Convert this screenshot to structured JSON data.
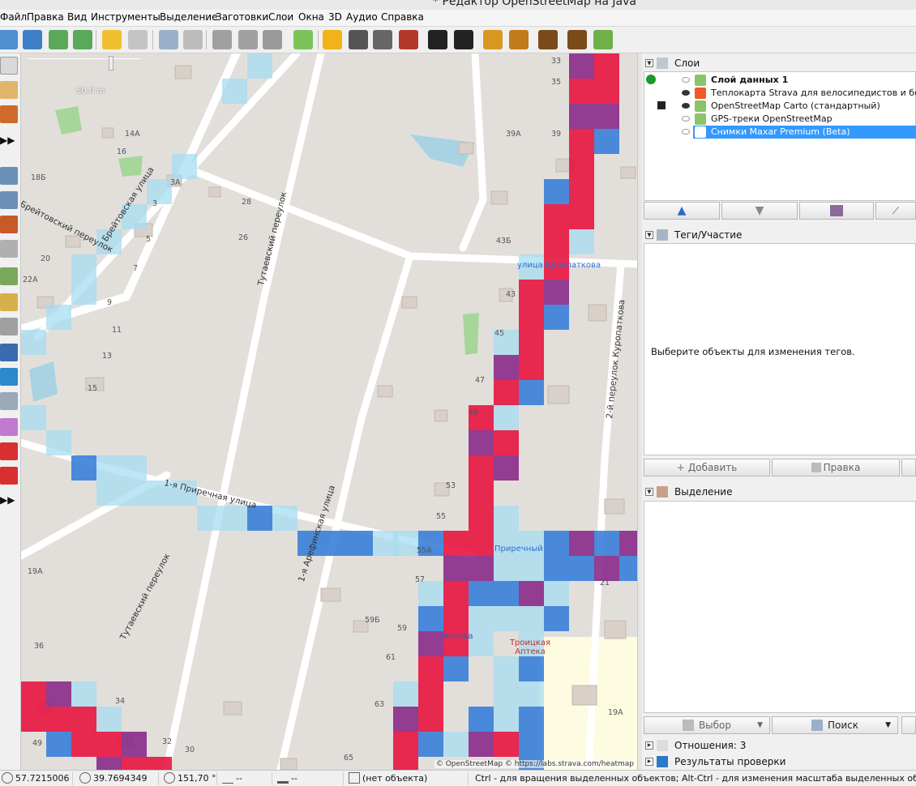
{
  "window": {
    "title": "* Редактор OpenStreetMap на Java"
  },
  "menu": [
    "Файл",
    "Правка",
    "Вид",
    "Инструменты",
    "Выделение",
    "Заготовки",
    "Слои",
    "Окна",
    "3D",
    "Аудио",
    "Справка"
  ],
  "map": {
    "scale_label": "50.0 m",
    "attribution": "© OpenStreetMap © https://labs.strava.com/heatmap",
    "streets": [
      "Брейтовская улица",
      "Брейтовский переулок",
      "Тутаевский переулок",
      "Тутаевский переулок",
      "1-я Приречная улица",
      "1-я Арефинская улица",
      "2-й переулок Куропаткова",
      "улица Куропаткова",
      "Приречный"
    ],
    "house_numbers": [
      "33",
      "35",
      "39",
      "39А",
      "43Б",
      "43",
      "45",
      "47",
      "49",
      "53",
      "55",
      "55А",
      "57",
      "59Б",
      "59",
      "61",
      "63",
      "65",
      "21",
      "19А",
      "14А",
      "16",
      "18Б",
      "3А",
      "3",
      "28",
      "26",
      "5",
      "7",
      "20",
      "22А",
      "9",
      "11",
      "13",
      "15",
      "19А",
      "36",
      "34",
      "32",
      "30",
      "49"
    ],
    "pois": [
      "Аптека",
      "Троицкая Аптека"
    ]
  },
  "panels": {
    "layers": {
      "title": "Слои",
      "items": [
        {
          "name": "Слой данных 1",
          "bold": true,
          "visible": false,
          "selected": false
        },
        {
          "name": "Теплокарта Strava для велосипедистов и бегунов",
          "bold": false,
          "visible": true,
          "selected": false
        },
        {
          "name": "OpenStreetMap Carto (стандартный)",
          "bold": false,
          "visible": true,
          "selected": false
        },
        {
          "name": "GPS-треки OpenStreetMap",
          "bold": false,
          "visible": false,
          "selected": false
        },
        {
          "name": "Снимки Maxar Premium (Beta)",
          "bold": false,
          "visible": false,
          "selected": true
        }
      ]
    },
    "tags": {
      "title": "Теги/Участие",
      "empty_message": "Выберите объекты для изменения тегов.",
      "add_button": "Добавить",
      "edit_button": "Правка"
    },
    "selection": {
      "title": "Выделение",
      "select_button": "Выбор",
      "search_button": "Поиск"
    },
    "relations": {
      "title": "Отношения: 3"
    },
    "validation": {
      "title": "Результаты проверки"
    }
  },
  "status": {
    "lat": "57.7215006",
    "lon": "39.7694349",
    "heading": "151,70 °",
    "angle": "--",
    "distance": "--",
    "object": "(нет объекта)",
    "hint": "Ctrl - для вращения выделенных объектов; Alt-Ctrl - для изменения масштаба выделенных объектов; или"
  },
  "colors": {
    "heat_red": "#e8143f",
    "heat_purple": "#8a2a8a",
    "heat_blue": "#3a80d8",
    "heat_light": "#a6dcf2",
    "selection": "#3399ff"
  }
}
